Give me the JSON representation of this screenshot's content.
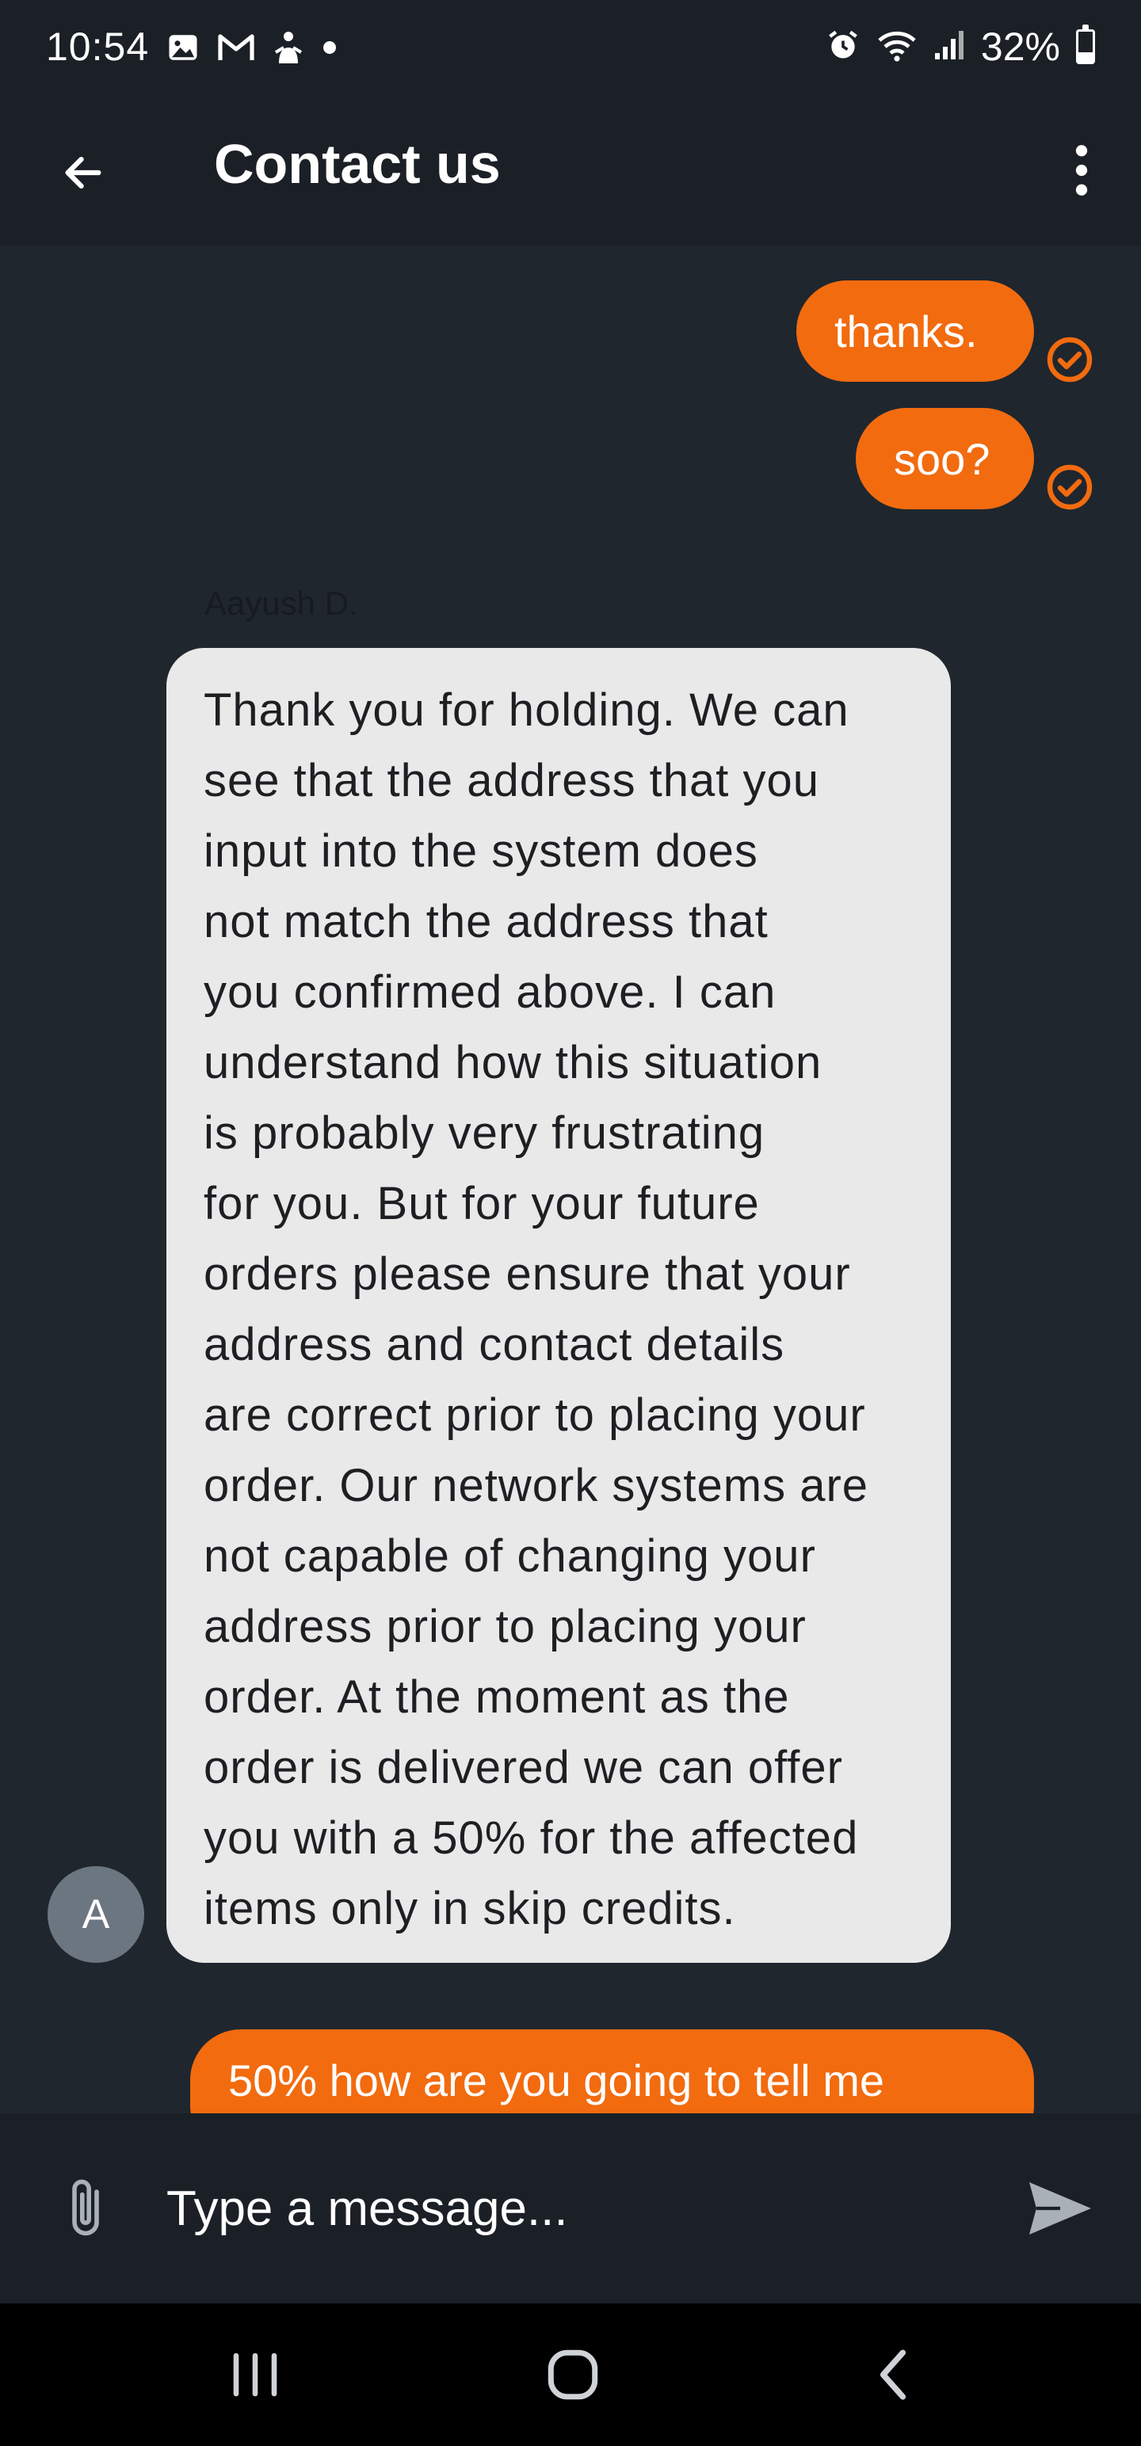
{
  "status_bar": {
    "time": "10:54",
    "battery_text": "32%",
    "left_icons": [
      "gallery-icon",
      "gmail-icon",
      "notification-app-icon",
      "dot-icon"
    ],
    "right_icons": [
      "alarm-icon",
      "wifi-icon",
      "signal-icon",
      "battery-icon"
    ]
  },
  "app_bar": {
    "title": "Contact us",
    "back_icon": "arrow-left-icon",
    "menu_icon": "more-vert-icon"
  },
  "messages": {
    "outgoing_1": {
      "text": "thanks.",
      "status_icon": "read-check-icon"
    },
    "outgoing_2": {
      "text": "soo?",
      "status_icon": "read-check-icon"
    },
    "incoming": {
      "sender": "Aayush D.",
      "avatar_initial": "A",
      "lines": [
        "Thank you for holding. We can",
        "see that the address that you",
        "input into the system does",
        "not match the address that",
        "you confirmed above. I can",
        "understand how this situation",
        "is probably very frustrating",
        "for you. But for your future",
        "orders please ensure that your",
        "address and contact details",
        "are correct prior to placing your",
        "order. Our network systems are",
        "not capable of changing your",
        "address prior to placing your",
        "order. At the moment as the",
        "order is delivered we can offer",
        "you with a 50% for the affected",
        "items only in skip credits."
      ]
    },
    "outgoing_3": {
      "text": "50% how are you going to tell me"
    }
  },
  "composer": {
    "placeholder": "Type a message...",
    "attach_icon": "paperclip-icon",
    "send_icon": "send-icon"
  },
  "nav_bar": {
    "recents_icon": "recents-icon",
    "home_icon": "home-icon",
    "back_icon": "back-chevron-icon"
  },
  "colors": {
    "accent": "#f26b0f",
    "background": "#1f262e",
    "app_bar": "#1b2027",
    "incoming_bubble": "#e9e9e9"
  }
}
